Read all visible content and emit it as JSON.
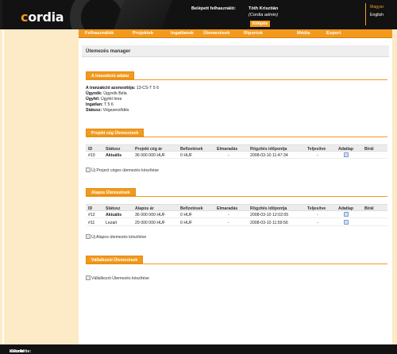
{
  "header": {
    "logo": "cordia",
    "logged_in_label": "Belépett felhasználó:",
    "user_name": "Tóth Krisztián",
    "user_role": "(Cordia admin)",
    "logout_label": "Kilépés",
    "languages": [
      "Magyar",
      "English"
    ]
  },
  "nav": {
    "items": [
      "Felhasználók",
      "Projektek",
      "Ingatlanok",
      "Ütemezések",
      "Riportok",
      "Média",
      "Export"
    ]
  },
  "main": {
    "page_title": "Ütemezés manager",
    "transaction": {
      "tab_label": "A tranzakció adatai",
      "rows": [
        {
          "label": "A tranzakció azonosítója:",
          "value": "13-CS-T 5 6"
        },
        {
          "label": "Ügynök:",
          "value": "Ügynök Béla"
        },
        {
          "label": "Ügyfél:",
          "value": "Ügyfél Imre"
        },
        {
          "label": "Ingatlan:",
          "value": "T 5 6"
        },
        {
          "label": "Státusz:",
          "value": "Végszerződés"
        }
      ]
    },
    "project_schedule": {
      "tab_label": "Projekt cég Ütemezések",
      "columns": [
        "ID",
        "Státusz",
        "Projekt cég ár",
        "Befizetések",
        "Elmaradás",
        "Rögzítés időpontja",
        "Teljesítve",
        "Adatlap",
        "Bírál"
      ],
      "rows": [
        {
          "id": "#10",
          "status": "Aktuális",
          "price": "36 000 000 HUF",
          "payments": "0 HUF",
          "arrears": "-",
          "recorded": "2008-03-10 11:47:34",
          "completed": "-"
        }
      ],
      "action_label": "Új Project céges ütemezés készítése"
    },
    "base_schedule": {
      "tab_label": "Alapos Ütemezések",
      "columns": [
        "ID",
        "Státusz",
        "Alapos ár",
        "Befizetések",
        "Elmaradás",
        "Rögzítés időpontja",
        "Teljesítve",
        "Adatlap",
        "Bírál"
      ],
      "rows": [
        {
          "id": "#12",
          "status": "Aktuális",
          "price": "36 000 000 HUF",
          "payments": "0 HUF",
          "arrears": "-",
          "recorded": "2008-03-10 12:02:05",
          "completed": "-"
        },
        {
          "id": "#11",
          "status": "Lezárt",
          "price": "29 000 000 HUF",
          "payments": "0 HUF",
          "arrears": "-",
          "recorded": "2008-03-10 11:59:56",
          "completed": "-"
        }
      ],
      "action_label": "Új Alapos ütemezés készítése"
    },
    "business_schedule": {
      "tab_label": "Vállalkozói Ütemezések",
      "action_label": "Vállalkozói Ütemezés készítése"
    }
  },
  "footer": {
    "label": "Készítette:",
    "author": "eWorld"
  },
  "colors": {
    "accent": "#f39a1e",
    "header_bg": "#121212",
    "side_bg": "#fdeac6"
  }
}
